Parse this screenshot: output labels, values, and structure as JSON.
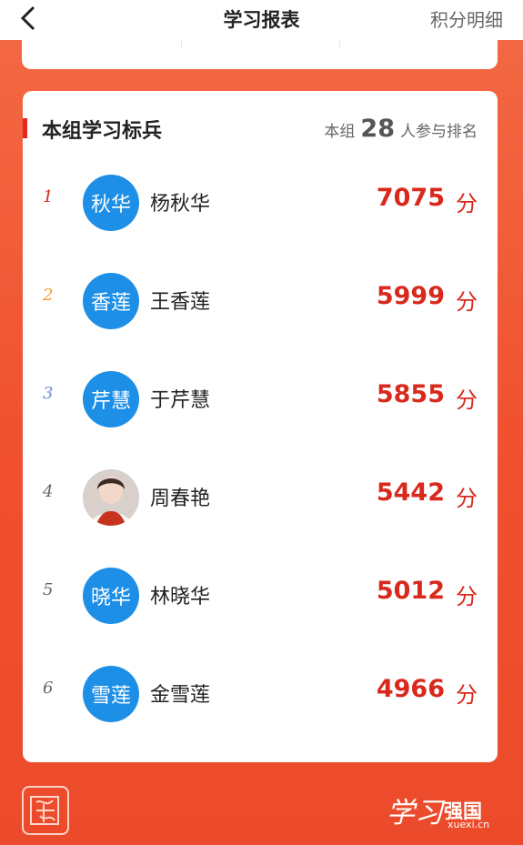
{
  "header": {
    "title": "学习报表",
    "right_link": "积分明细"
  },
  "group": {
    "title": "本组学习标兵",
    "count_prefix": "本组",
    "count": "28",
    "count_suffix": "人参与排名"
  },
  "leaders": [
    {
      "rank": "1",
      "avatar_text": "秋华",
      "name": "杨秋华",
      "score": "7075",
      "unit": "分",
      "rank_color": "#d8291c"
    },
    {
      "rank": "2",
      "avatar_text": "香莲",
      "name": "王香莲",
      "score": "5999",
      "unit": "分",
      "rank_color": "#f29b31"
    },
    {
      "rank": "3",
      "avatar_text": "芹慧",
      "name": "于芹慧",
      "score": "5855",
      "unit": "分",
      "rank_color": "#6a8fd4"
    },
    {
      "rank": "4",
      "avatar_text": "",
      "name": "周春艳",
      "score": "5442",
      "unit": "分",
      "rank_color": "#666666",
      "avatar_type": "photo"
    },
    {
      "rank": "5",
      "avatar_text": "晓华",
      "name": "林晓华",
      "score": "5012",
      "unit": "分",
      "rank_color": "#666666"
    },
    {
      "rank": "6",
      "avatar_text": "雪莲",
      "name": "金雪莲",
      "score": "4966",
      "unit": "分",
      "rank_color": "#666666"
    }
  ],
  "footer": {
    "logo_script": "学习",
    "logo_text": "强国",
    "logo_sub": "xuexi.cn"
  },
  "colors": {
    "brand_red": "#d8291c",
    "avatar_blue": "#1e8fe6"
  }
}
